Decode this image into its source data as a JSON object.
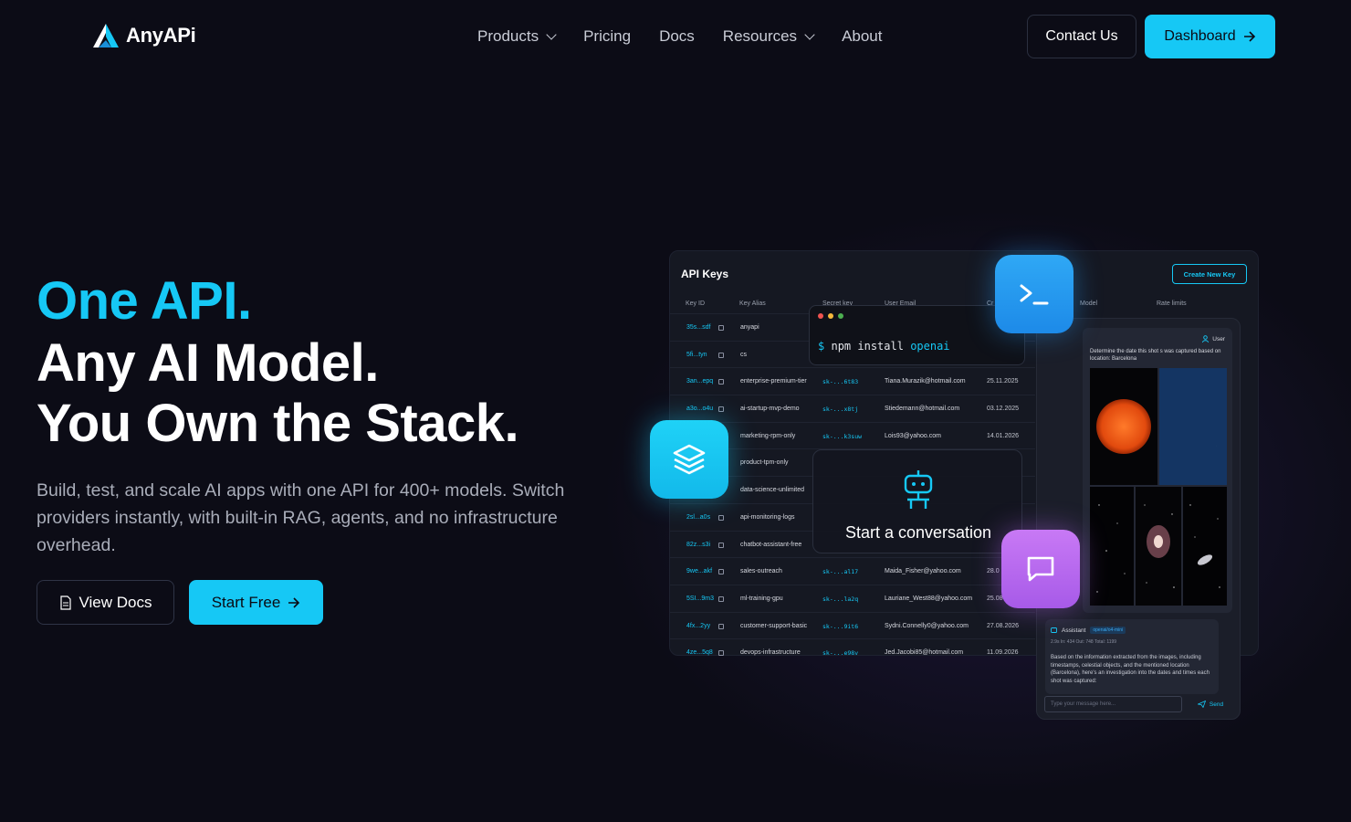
{
  "brand": {
    "name": "AnyAPi",
    "accent": "#16c8f5"
  },
  "nav": {
    "items": [
      {
        "label": "Products",
        "dropdown": true
      },
      {
        "label": "Pricing",
        "dropdown": false
      },
      {
        "label": "Docs",
        "dropdown": false
      },
      {
        "label": "Resources",
        "dropdown": true
      },
      {
        "label": "About",
        "dropdown": false
      }
    ],
    "contact_label": "Contact Us",
    "dashboard_label": "Dashboard"
  },
  "hero": {
    "line1": "One API.",
    "line2": "Any AI Model.",
    "line3": "You Own the Stack.",
    "subtitle": "Build, test, and scale AI apps with one API for 400+ models. Switch providers instantly, with built-in RAG, agents, and no infrastructure overhead.",
    "docs_label": "View Docs",
    "start_label": "Start Free"
  },
  "mockup": {
    "panel_title": "API Keys",
    "create_label": "Create New Key",
    "columns": [
      "Key ID",
      "Key Alias",
      "Secret key",
      "User Email",
      "Cr",
      "Model",
      "Rate limits"
    ],
    "rows": [
      {
        "id": "35s...sdf",
        "alias": "anyapi",
        "secret": "",
        "email": "",
        "date": ""
      },
      {
        "id": "5fi...tyn",
        "alias": "cs",
        "secret": "",
        "email": "",
        "date": ""
      },
      {
        "id": "3an...epq",
        "alias": "enterprise-premium-tier",
        "secret": "sk-...6t83",
        "email": "Tiana.Murazik@hotmail.com",
        "date": "25.11.2025"
      },
      {
        "id": "a3o...o4u",
        "alias": "ai-startup-mvp-demo",
        "secret": "sk-...x8tj",
        "email": "Stiedemann@hotmail.com",
        "date": "03.12.2025"
      },
      {
        "id": "",
        "alias": "marketing-rpm-only",
        "secret": "sk-...k3suw",
        "email": "Lois93@yahoo.com",
        "date": "14.01.2026"
      },
      {
        "id": "",
        "alias": "product-tpm-only",
        "secret": "",
        "email": "",
        "date": ""
      },
      {
        "id": "",
        "alias": "data-science-unlimited",
        "secret": "",
        "email": "",
        "date": ""
      },
      {
        "id": "2sl...a0s",
        "alias": "api-monitoring-logs",
        "secret": "",
        "email": "",
        "date": ""
      },
      {
        "id": "82z...s3i",
        "alias": "chatbot-assistant-free",
        "secret": "",
        "email": "",
        "date": ""
      },
      {
        "id": "9we...akf",
        "alias": "sales-outreach",
        "secret": "sk-...al17",
        "email": "Maida_Fisher@yahoo.com",
        "date": "28.0"
      },
      {
        "id": "5SI...9m3",
        "alias": "ml-training-gpu",
        "secret": "sk-...la2q",
        "email": "Lauriane_West88@yahoo.com",
        "date": "25.08"
      },
      {
        "id": "4fx...2yy",
        "alias": "customer-support-basic",
        "secret": "sk-...9it6",
        "email": "Sydni.Connelly0@yahoo.com",
        "date": "27.08.2026"
      },
      {
        "id": "4ze...5q8",
        "alias": "devops-infrastructure",
        "secret": "sk-...e98v",
        "email": "Jed.Jacobi85@hotmail.com",
        "date": "11.09.2026"
      }
    ],
    "terminal": {
      "prompt": "$",
      "command": "npm install",
      "package": "openai"
    },
    "conversation_label": "Start a conversation",
    "chat": {
      "user_label": "User",
      "user_question": "Determine the date this shot s was captured based on location: Barcelona",
      "assistant_label": "Assistant",
      "assistant_model": "openai/o4-mini",
      "assistant_stats": "2.9s   In: 434   Out: 748   Total: 1199",
      "assistant_body": "Based on the information extracted from the images, including timestamps, celestial objects, and the mentioned location (Barcelona), here's an investigation into the dates and times each shot was captured:",
      "input_placeholder": "Type your message here...",
      "send_label": "Send"
    }
  }
}
